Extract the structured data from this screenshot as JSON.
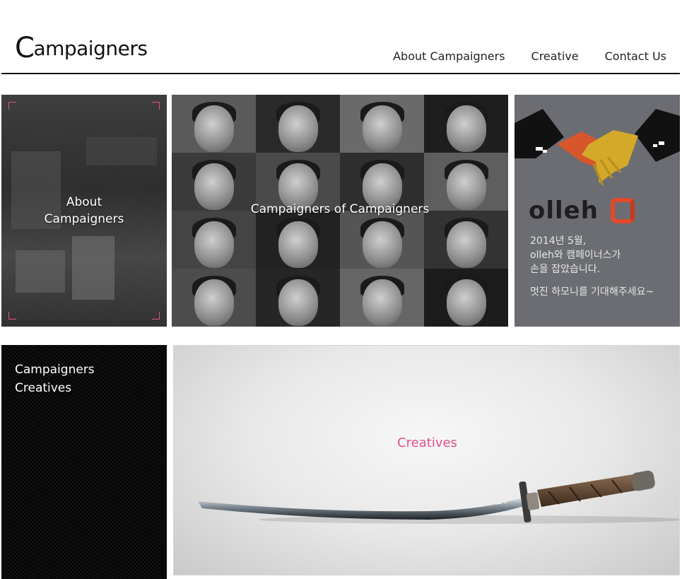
{
  "header": {
    "logo": {
      "initial": "C",
      "rest": "ampaigners"
    },
    "nav": [
      "About Campaigners",
      "Creative",
      "Contact Us"
    ]
  },
  "tiles": {
    "about": {
      "caption_line1": "About",
      "caption_line2": "Campaigners"
    },
    "faces": {
      "caption": "Campaigners of Campaigners"
    },
    "olleh": {
      "brand": "olleh",
      "line1": "2014년 5월,",
      "line2": "olleh와 캠페이너스가",
      "line3": "손을 잡았습니다.",
      "line4": "멋진 하모니를 기대해주세요~"
    },
    "creatives_text": {
      "line1": "Campaigners",
      "line2": "Creatives"
    },
    "creatives_image": {
      "caption": "Creatives"
    }
  },
  "colors": {
    "accent_pink": "#e0508a",
    "header_rule": "#111111",
    "olleh_tile": "#6b6d72",
    "olleh_logo_red": "#e24a2a",
    "handshake_gold": "#d4a92a",
    "handshake_orange": "#d8562c"
  }
}
